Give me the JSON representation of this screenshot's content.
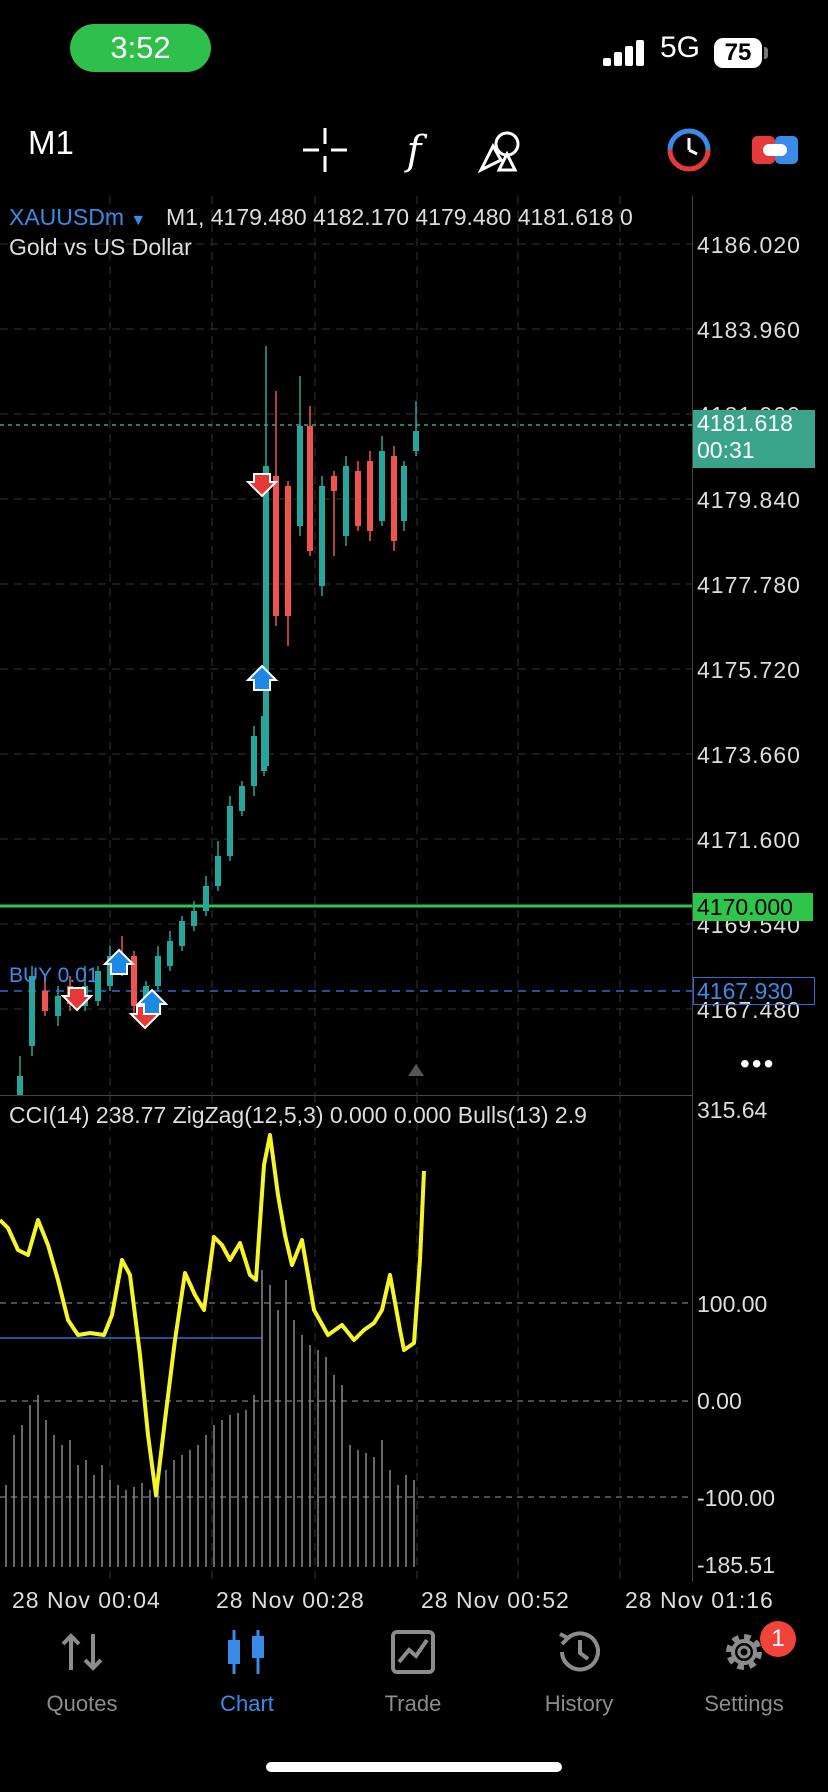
{
  "status_bar": {
    "time": "3:52",
    "network": "5G",
    "battery": "75"
  },
  "toolbar": {
    "timeframe": "M1",
    "icons": [
      "crosshair-icon",
      "indicators-f-icon",
      "objects-icon",
      "clock-icon",
      "trade-toggle-icon"
    ]
  },
  "chart": {
    "symbol": "XAUUSDm",
    "ohlc_line": "M1, 4179.480 4182.170 4179.480 4181.618 0",
    "description": "Gold vs US Dollar",
    "price_labels": [
      "4186.020",
      "4183.960",
      "4181.900",
      "4179.840",
      "4177.780",
      "4175.720",
      "4173.660",
      "4171.600",
      "4169.540",
      "4167.480"
    ],
    "current_price": "4181.618",
    "countdown": "00:31",
    "level_price": "4170.000",
    "buy_price": "4167.930",
    "buy_label": "BUY 0.01",
    "more": "•••",
    "colors": {
      "bull": "#26a69a",
      "bear": "#ef5350",
      "level": "#2fc54a",
      "buy": "#2f6ad8",
      "cci": "#f5f52a"
    }
  },
  "indicator": {
    "header": "CCI(14)  238.77  ZigZag(12,5,3)  0.000  0.000  Bulls(13)  2.9",
    "labels": [
      "315.64",
      "100.00",
      "0.00",
      "-100.00",
      "-185.51"
    ]
  },
  "x_axis": [
    "28 Nov 00:04",
    "28 Nov 00:28",
    "28 Nov 00:52",
    "28 Nov 01:16"
  ],
  "nav": [
    {
      "label": "Quotes",
      "icon": "quotes-icon",
      "active": false
    },
    {
      "label": "Chart",
      "icon": "chart-icon",
      "active": true
    },
    {
      "label": "Trade",
      "icon": "trade-icon",
      "active": false
    },
    {
      "label": "History",
      "icon": "history-icon",
      "active": false
    },
    {
      "label": "Settings",
      "icon": "settings-icon",
      "active": false
    }
  ],
  "settings_badge": "1"
}
